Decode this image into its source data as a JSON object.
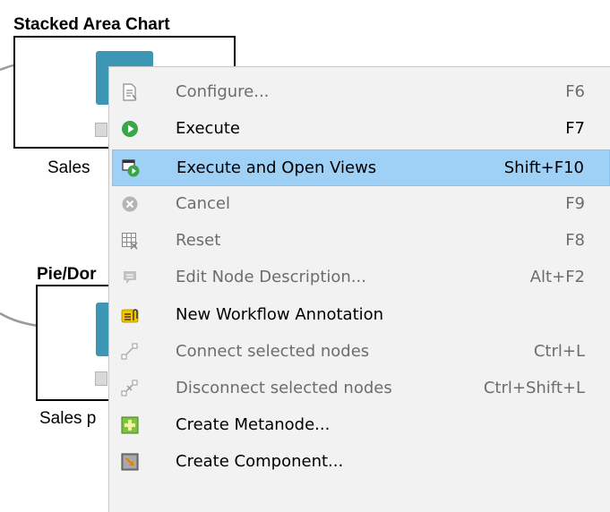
{
  "canvas": {
    "nodes": [
      {
        "title": "Stacked Area Chart",
        "label": "Sales"
      },
      {
        "title": "Pie/Dor",
        "label": "Sales p"
      }
    ]
  },
  "context_menu": {
    "items": [
      {
        "label": "Configure...",
        "shortcut": "F6",
        "icon": "configure-icon",
        "enabled": false
      },
      {
        "label": "Execute",
        "shortcut": "F7",
        "icon": "execute-icon",
        "enabled": true
      },
      {
        "label": "Execute and Open Views",
        "shortcut": "Shift+F10",
        "icon": "execute-open-views-icon",
        "enabled": true,
        "highlighted": true
      },
      {
        "label": "Cancel",
        "shortcut": "F9",
        "icon": "cancel-icon",
        "enabled": false
      },
      {
        "label": "Reset",
        "shortcut": "F8",
        "icon": "reset-icon",
        "enabled": false
      },
      {
        "label": "Edit Node Description...",
        "shortcut": "Alt+F2",
        "icon": "edit-description-icon",
        "enabled": false
      },
      {
        "label": "New Workflow Annotation",
        "shortcut": "",
        "icon": "annotation-icon",
        "enabled": true
      },
      {
        "label": "Connect selected nodes",
        "shortcut": "Ctrl+L",
        "icon": "connect-nodes-icon",
        "enabled": false
      },
      {
        "label": "Disconnect selected nodes",
        "shortcut": "Ctrl+Shift+L",
        "icon": "disconnect-nodes-icon",
        "enabled": false
      },
      {
        "label": "Create Metanode...",
        "shortcut": "",
        "icon": "metanode-icon",
        "enabled": true
      },
      {
        "label": "Create Component...",
        "shortcut": "",
        "icon": "component-icon",
        "enabled": true
      }
    ]
  },
  "colors": {
    "highlight": "#9fd0f5",
    "node_icon": "#3d97b4",
    "execute_green": "#3aa64a",
    "menu_background": "#f2f2f2"
  }
}
